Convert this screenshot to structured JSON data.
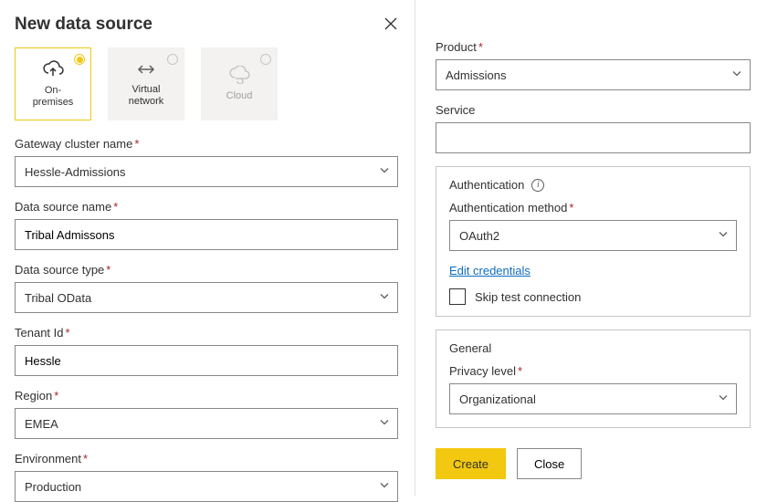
{
  "header": {
    "title": "New data source"
  },
  "types": {
    "onprem": "On-\npremises",
    "vnet": "Virtual\nnetwork",
    "cloud": "Cloud"
  },
  "left": {
    "gateway_label": "Gateway cluster name",
    "gateway_value": "Hessle-Admissions",
    "dsname_label": "Data source name",
    "dsname_value": "Tribal Admissons",
    "dstype_label": "Data source type",
    "dstype_value": "Tribal OData",
    "tenant_label": "Tenant Id",
    "tenant_value": "Hessle",
    "region_label": "Region",
    "region_value": "EMEA",
    "env_label": "Environment",
    "env_value": "Production"
  },
  "right": {
    "product_label": "Product",
    "product_value": "Admissions",
    "service_label": "Service",
    "service_value": "",
    "auth_section": "Authentication",
    "authmethod_label": "Authentication method",
    "authmethod_value": "OAuth2",
    "edit_credentials": "Edit credentials",
    "skip_test": "Skip test connection",
    "general_section": "General",
    "privacy_label": "Privacy level",
    "privacy_value": "Organizational"
  },
  "buttons": {
    "create": "Create",
    "close": "Close"
  }
}
